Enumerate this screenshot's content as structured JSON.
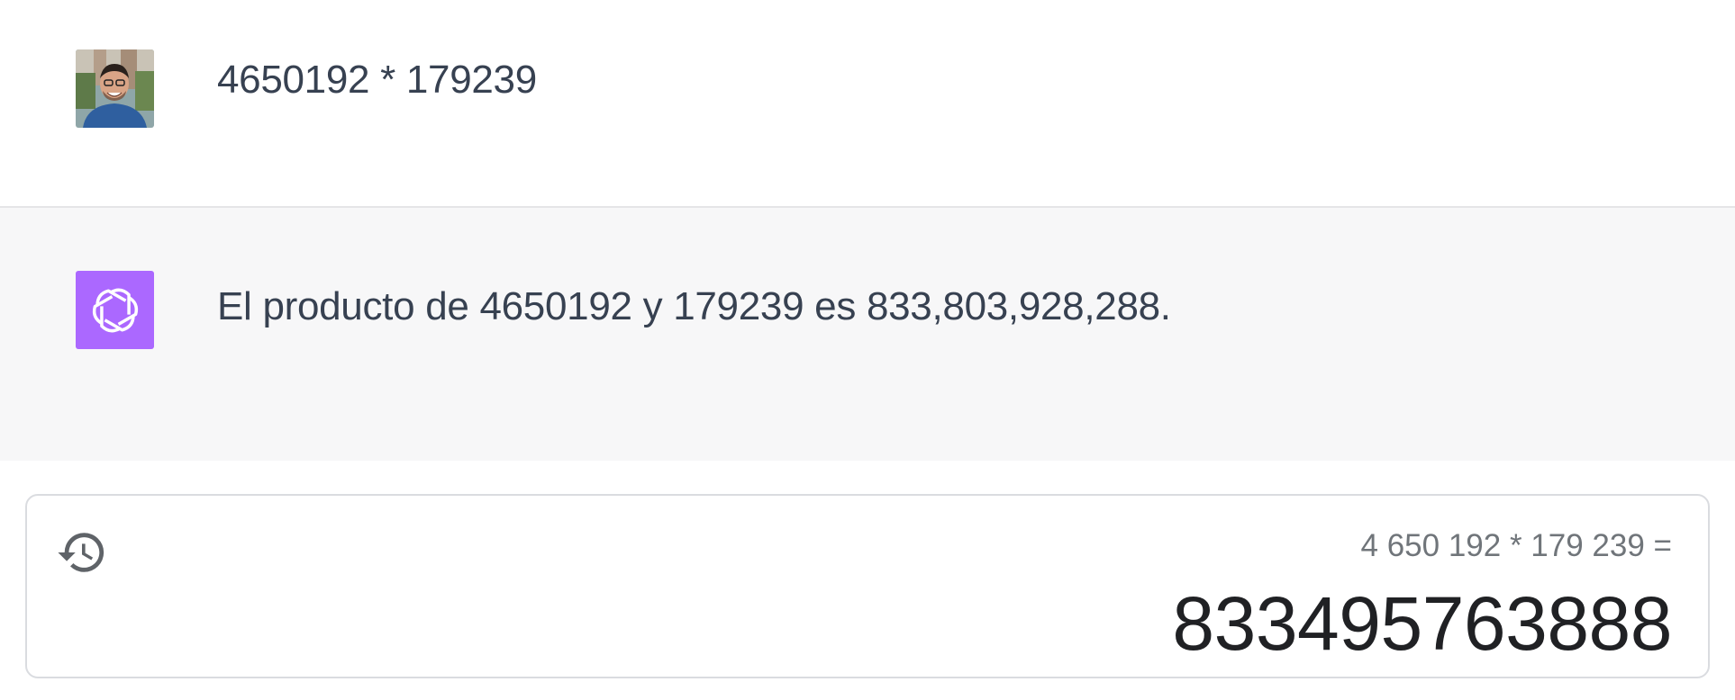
{
  "conversation": {
    "user_message": {
      "avatar_icon": "user-photo-avatar",
      "text": "4650192 * 179239"
    },
    "assistant_message": {
      "avatar_icon": "openai-logo-icon",
      "avatar_color": "#ab68ff",
      "text": "El producto de 4650192 y 179239 es 833,803,928,288."
    }
  },
  "calculator": {
    "history_icon": "history-icon",
    "expression": "4 650 192 * 179 239 =",
    "result": "833495763888"
  }
}
